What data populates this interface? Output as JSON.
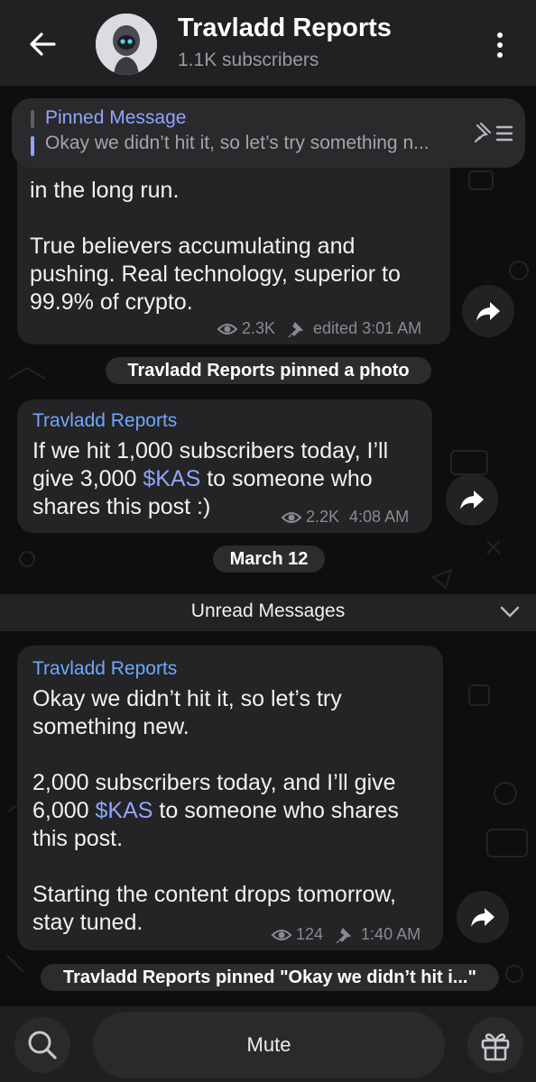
{
  "header": {
    "title": "Travladd Reports",
    "subscribers": "1.1K subscribers"
  },
  "pinned": {
    "title": "Pinned Message",
    "text": "Okay we didn’t hit it, so let’s try something n..."
  },
  "messages": [
    {
      "text_end": "in the long run.\n\nTrue believers accumulating and pushing. Real technology, superior to 99.9% of crypto.",
      "views": "2.3K",
      "time": "edited 3:01 AM"
    },
    {
      "sender": "Travladd Reports",
      "text_a": "If we hit 1,000 subscribers today, I’ll give 3,000 ",
      "cashtag": "$KAS",
      "text_b": " to someone who shares this post :)",
      "views": "2.2K",
      "time": "4:08 AM"
    },
    {
      "sender": "Travladd Reports",
      "text_a": "Okay we didn’t hit it, so let’s try something new.\n\n2,000 subscribers today, and I’ll give 6,000 ",
      "cashtag": "$KAS",
      "text_b": " to someone who shares this post.\n\nStarting the content drops tomorrow, stay tuned.",
      "views": "124",
      "time": "1:40 AM"
    }
  ],
  "service": {
    "pinned_photo": "Travladd Reports pinned a photo",
    "date": "March 12",
    "pinned_message": "Travladd Reports pinned \"Okay we didn’t hit i...\""
  },
  "unread": "Unread Messages",
  "bottom": {
    "mute": "Mute"
  },
  "colors": {
    "accent": "#8fa5ff",
    "sender": "#6fa8ff",
    "bubble": "#242426",
    "background": "#0e0e10"
  }
}
